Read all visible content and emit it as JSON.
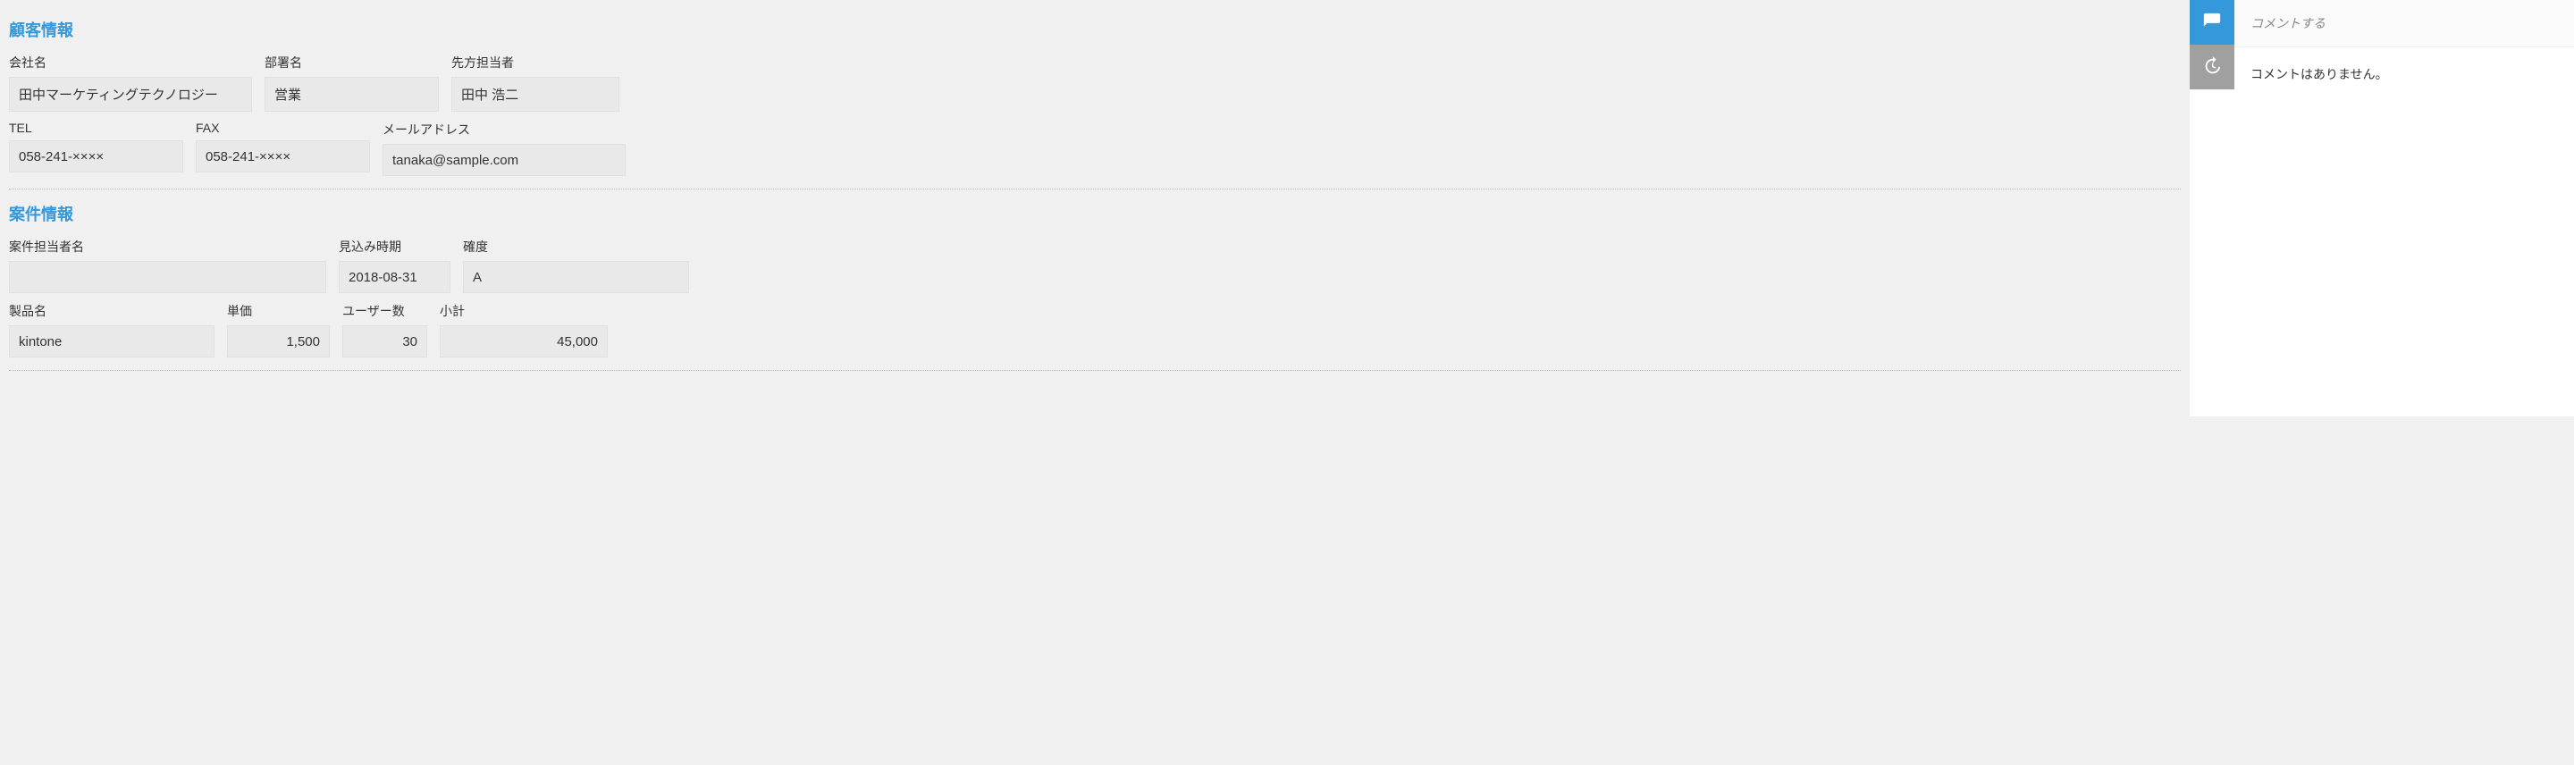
{
  "sections": {
    "customer": {
      "title": "顧客情報",
      "company_label": "会社名",
      "company_value": "田中マーケティングテクノロジー",
      "department_label": "部署名",
      "department_value": "営業",
      "contact_label": "先方担当者",
      "contact_value": "田中 浩二",
      "tel_label": "TEL",
      "tel_value": "058-241-××××",
      "fax_label": "FAX",
      "fax_value": "058-241-××××",
      "email_label": "メールアドレス",
      "email_value": "tanaka@sample.com"
    },
    "deal": {
      "title": "案件情報",
      "owner_label": "案件担当者名",
      "owner_value": "",
      "expected_label": "見込み時期",
      "expected_value": "2018-08-31",
      "probability_label": "確度",
      "probability_value": "A",
      "product_label": "製品名",
      "product_value": "kintone",
      "unit_price_label": "単価",
      "unit_price_value": "1,500",
      "users_label": "ユーザー数",
      "users_value": "30",
      "subtotal_label": "小計",
      "subtotal_value": "45,000"
    }
  },
  "comments": {
    "placeholder": "コメントする",
    "empty_text": "コメントはありません。"
  }
}
